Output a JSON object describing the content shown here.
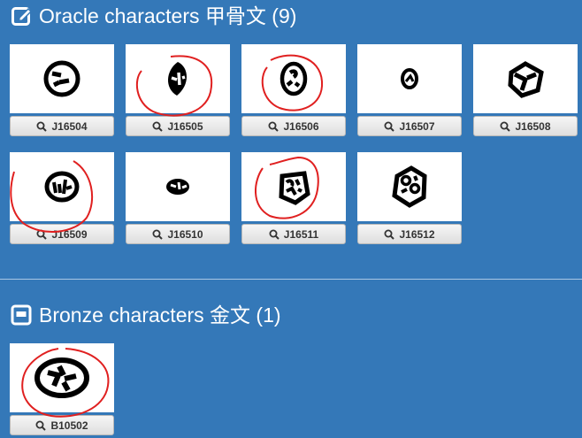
{
  "oracle": {
    "title": "Oracle characters 甲骨文 (9)",
    "icon": "edit-square-icon",
    "items": [
      {
        "id": "J16504"
      },
      {
        "id": "J16505"
      },
      {
        "id": "J16506"
      },
      {
        "id": "J16507"
      },
      {
        "id": "J16508"
      },
      {
        "id": "J16509"
      },
      {
        "id": "J16510"
      },
      {
        "id": "J16511"
      },
      {
        "id": "J16512"
      }
    ]
  },
  "bronze": {
    "title": "Bronze characters 金文 (1)",
    "icon": "window-square-icon",
    "items": [
      {
        "id": "B10502"
      }
    ]
  },
  "colors": {
    "background": "#3478b8",
    "annotation_red": "#e02020",
    "button_text": "#333333"
  }
}
